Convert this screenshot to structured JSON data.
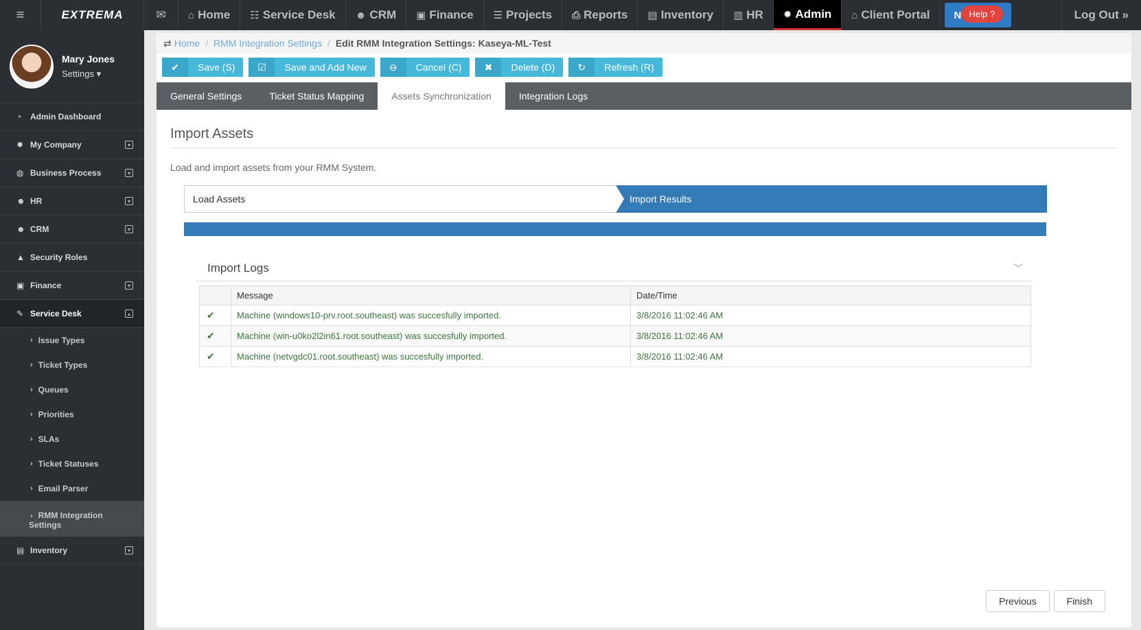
{
  "topbar": {
    "logo": "EXTREMA",
    "nav": [
      {
        "label": "Home",
        "icon": "home-icon",
        "glyph": "⌂"
      },
      {
        "label": "Service Desk",
        "icon": "sitemap-icon",
        "glyph": "☷"
      },
      {
        "label": "CRM",
        "icon": "users-icon",
        "glyph": "☻"
      },
      {
        "label": "Finance",
        "icon": "money-icon",
        "glyph": "▣"
      },
      {
        "label": "Projects",
        "icon": "list-icon",
        "glyph": "☰"
      },
      {
        "label": "Reports",
        "icon": "print-icon",
        "glyph": "⎙"
      },
      {
        "label": "Inventory",
        "icon": "clipboard-icon",
        "glyph": "▤"
      },
      {
        "label": "HR",
        "icon": "briefcase-icon",
        "glyph": "▥"
      },
      {
        "label": "Admin",
        "icon": "gear-icon",
        "glyph": "✹"
      },
      {
        "label": "Client Portal",
        "icon": "home-icon",
        "glyph": "⌂"
      }
    ],
    "n_label": "N",
    "help_label": "Help",
    "logout_label": "Log Out »"
  },
  "sidebar": {
    "user_name": "Mary Jones",
    "settings_label": "Settings ▾",
    "items": [
      {
        "label": "Admin Dashboard",
        "icon": "dashboard-icon",
        "glyph": "◔"
      },
      {
        "label": "My Company",
        "icon": "gear-icon",
        "glyph": "✹"
      },
      {
        "label": "Business Process",
        "icon": "globe-icon",
        "glyph": "◍"
      },
      {
        "label": "HR",
        "icon": "users-icon",
        "glyph": "☻"
      },
      {
        "label": "CRM",
        "icon": "users-icon",
        "glyph": "☻"
      },
      {
        "label": "Security Roles",
        "icon": "lock-icon",
        "glyph": "▲"
      },
      {
        "label": "Finance",
        "icon": "money-icon",
        "glyph": "▣"
      },
      {
        "label": "Service Desk",
        "icon": "wrench-icon",
        "glyph": "✎"
      }
    ],
    "sub_items": [
      "Issue Types",
      "Ticket Types",
      "Queues",
      "Priorities",
      "SLAs",
      "Ticket Statuses",
      "Email Parser"
    ],
    "active_sub_line1": "RMM Integration",
    "active_sub_line2": "Settings",
    "inventory_label": "Inventory"
  },
  "breadcrumb": {
    "home": "Home",
    "section": "RMM Integration Settings",
    "current": "Edit RMM Integration Settings: Kaseya-ML-Test"
  },
  "toolbar": {
    "save": "Save (S)",
    "save_new": "Save and Add New",
    "cancel": "Cancel (C)",
    "delete": "Delete (D)",
    "refresh": "Refresh (R)"
  },
  "tabs": [
    "General Settings",
    "Ticket Status Mapping",
    "Assets Synchronization",
    "Integration Logs"
  ],
  "content": {
    "title": "Import Assets",
    "description": "Load and import assets from your RMM System.",
    "step1": "Load Assets",
    "step2": "Import Results",
    "progress": 1.0,
    "logs_title": "Import Logs",
    "columns": [
      "Message",
      "Date/Time"
    ],
    "rows": [
      {
        "message": "Machine (windows10-prv.root.southeast) was succesfully imported.",
        "datetime": "3/8/2016 11:02:46 AM"
      },
      {
        "message": "Machine (win-u0ko2l2in61.root.southeast) was succesfully imported.",
        "datetime": "3/8/2016 11:02:46 AM"
      },
      {
        "message": "Machine (netvgdc01.root.southeast) was succesfully imported.",
        "datetime": "3/8/2016 11:02:46 AM"
      }
    ],
    "previous": "Previous",
    "finish": "Finish"
  },
  "colors": {
    "accent": "#337ab7",
    "toolbar_button": "#46b8da",
    "success_text": "#3c763d",
    "help": "#e0443c"
  }
}
